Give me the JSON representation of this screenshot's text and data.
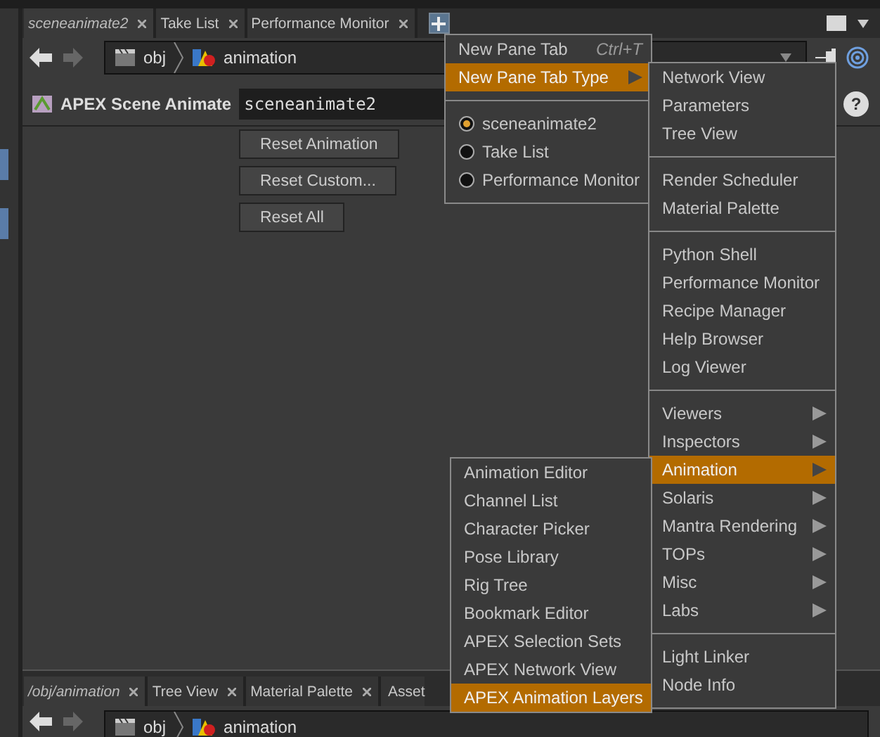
{
  "top_pane": {
    "tabs": [
      {
        "label": "sceneanimate2",
        "selected": true
      },
      {
        "label": "Take List",
        "selected": false
      },
      {
        "label": "Performance Monitor",
        "selected": false
      }
    ],
    "path": [
      "obj",
      "animation"
    ]
  },
  "parameters": {
    "node_type": "APEX Scene Animate",
    "node_name": "sceneanimate2",
    "help": "?",
    "buttons": [
      "Reset Animation",
      "Reset Custom...",
      "Reset All"
    ]
  },
  "bottom_pane": {
    "tabs": [
      {
        "label": "/obj/animation",
        "selected": true
      },
      {
        "label": "Tree View",
        "selected": false
      },
      {
        "label": "Material Palette",
        "selected": false
      },
      {
        "label": "Asset",
        "selected": false
      }
    ],
    "path": [
      "obj",
      "animation"
    ]
  },
  "tab_menu": {
    "items": [
      {
        "kind": "command",
        "label": "New Pane Tab",
        "shortcut": "Ctrl+T",
        "highlighted": false
      },
      {
        "kind": "submenu",
        "label": "New Pane Tab Type",
        "highlighted": true
      },
      {
        "kind": "separator"
      },
      {
        "kind": "radio",
        "label": "sceneanimate2",
        "selected": true
      },
      {
        "kind": "radio",
        "label": "Take List",
        "selected": false
      },
      {
        "kind": "radio",
        "label": "Performance Monitor",
        "selected": false
      }
    ]
  },
  "pane_type_menu": {
    "items": [
      {
        "kind": "command",
        "label": "Network View",
        "highlighted": false
      },
      {
        "kind": "command",
        "label": "Parameters",
        "highlighted": false
      },
      {
        "kind": "command",
        "label": "Tree View",
        "highlighted": false
      },
      {
        "kind": "separator"
      },
      {
        "kind": "command",
        "label": "Render Scheduler",
        "highlighted": false
      },
      {
        "kind": "command",
        "label": "Material Palette",
        "highlighted": false
      },
      {
        "kind": "separator"
      },
      {
        "kind": "command",
        "label": "Python Shell",
        "highlighted": false
      },
      {
        "kind": "command",
        "label": "Performance Monitor",
        "highlighted": false
      },
      {
        "kind": "command",
        "label": "Recipe Manager",
        "highlighted": false
      },
      {
        "kind": "command",
        "label": "Help Browser",
        "highlighted": false
      },
      {
        "kind": "command",
        "label": "Log Viewer",
        "highlighted": false
      },
      {
        "kind": "separator"
      },
      {
        "kind": "submenu",
        "label": "Viewers",
        "highlighted": false
      },
      {
        "kind": "submenu",
        "label": "Inspectors",
        "highlighted": false
      },
      {
        "kind": "submenu",
        "label": "Animation",
        "highlighted": true
      },
      {
        "kind": "submenu",
        "label": "Solaris",
        "highlighted": false
      },
      {
        "kind": "submenu",
        "label": "Mantra Rendering",
        "highlighted": false
      },
      {
        "kind": "submenu",
        "label": "TOPs",
        "highlighted": false
      },
      {
        "kind": "submenu",
        "label": "Misc",
        "highlighted": false
      },
      {
        "kind": "submenu",
        "label": "Labs",
        "highlighted": false
      },
      {
        "kind": "separator"
      },
      {
        "kind": "command",
        "label": "Light Linker",
        "highlighted": false
      },
      {
        "kind": "command",
        "label": "Node Info",
        "highlighted": false
      }
    ]
  },
  "animation_menu": {
    "items": [
      {
        "kind": "command",
        "label": "Animation Editor",
        "highlighted": false
      },
      {
        "kind": "command",
        "label": "Channel List",
        "highlighted": false
      },
      {
        "kind": "command",
        "label": "Character Picker",
        "highlighted": false
      },
      {
        "kind": "command",
        "label": "Pose Library",
        "highlighted": false
      },
      {
        "kind": "command",
        "label": "Rig Tree",
        "highlighted": false
      },
      {
        "kind": "command",
        "label": "Bookmark Editor",
        "highlighted": false
      },
      {
        "kind": "command",
        "label": "APEX Selection Sets",
        "highlighted": false
      },
      {
        "kind": "command",
        "label": "APEX Network View",
        "highlighted": false
      },
      {
        "kind": "command",
        "label": "APEX Animation Layers",
        "highlighted": true
      }
    ]
  }
}
